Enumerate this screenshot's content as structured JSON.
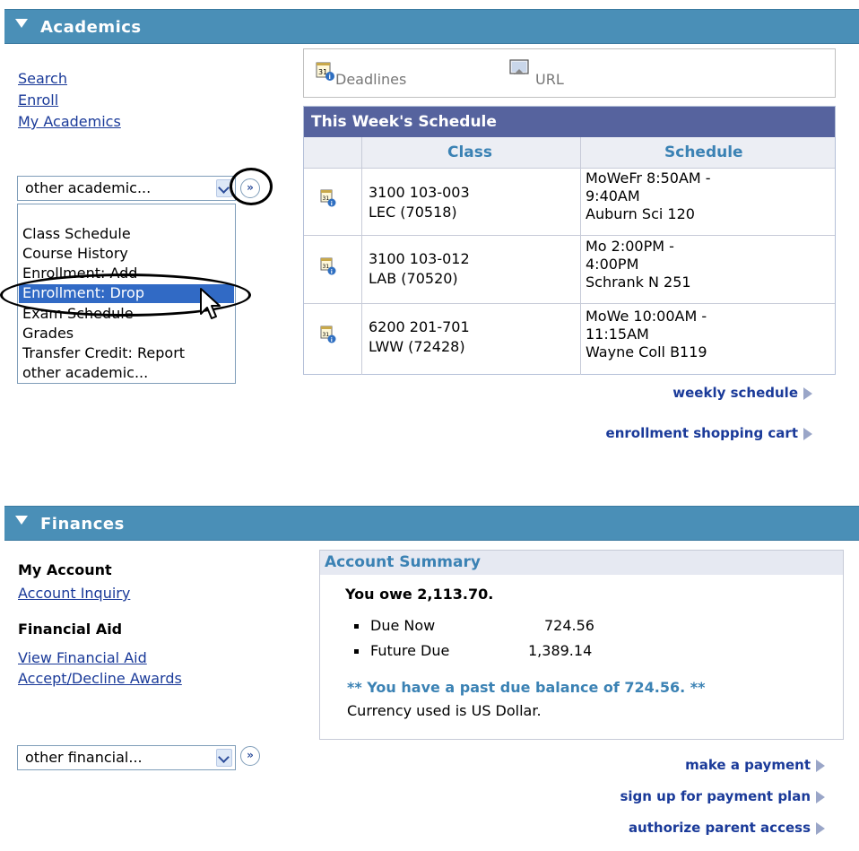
{
  "academics": {
    "header": "Academics",
    "links": [
      "Search",
      "Enroll",
      "My Academics"
    ],
    "select_value": "other academic...",
    "go_glyph": "»",
    "dropdown_options": [
      "Class Schedule",
      "Course History",
      "Enrollment: Add",
      "Enrollment: Drop",
      "Exam Schedule",
      "Grades",
      "Transfer Credit: Report",
      "other academic..."
    ],
    "selected_option": "Enrollment: Drop",
    "toolbar": {
      "deadlines": "Deadlines",
      "url": "URL"
    },
    "schedule": {
      "title": "This Week's Schedule",
      "columns": [
        "Class",
        "Schedule"
      ],
      "rows": [
        {
          "class_line1": "3100 103-003",
          "class_line2": "LEC (70518)",
          "sched_line1": "MoWeFr 8:50AM -",
          "sched_line2": "9:40AM",
          "sched_line3": "Auburn Sci 120"
        },
        {
          "class_line1": "3100 103-012",
          "class_line2": "LAB (70520)",
          "sched_line1": "Mo 2:00PM -",
          "sched_line2": "4:00PM",
          "sched_line3": "Schrank N 251"
        },
        {
          "class_line1": "6200 201-701",
          "class_line2": "LWW (72428)",
          "sched_line1": "MoWe 10:00AM -",
          "sched_line2": "11:15AM",
          "sched_line3": "Wayne Coll B119"
        }
      ]
    },
    "weekly_schedule": "weekly schedule",
    "shopping_cart": "enrollment shopping cart"
  },
  "finances": {
    "header": "Finances",
    "my_account_heading": "My Account",
    "account_inquiry": "Account Inquiry",
    "financial_aid_heading": "Financial Aid",
    "view_financial_aid": "View Financial Aid",
    "accept_decline": "Accept/Decline Awards",
    "select_value": "other financial...",
    "summary": {
      "title": "Account Summary",
      "owe": "You owe 2,113.70.",
      "due_now_label": "Due Now",
      "due_now_value": "724.56",
      "future_due_label": "Future Due",
      "future_due_value": "1,389.14",
      "past_due": "** You have a past due balance of 724.56. **",
      "currency": "Currency used is US Dollar."
    },
    "make_payment": "make a payment",
    "payment_plan": "sign up for payment plan",
    "parent_access": "authorize parent access"
  },
  "colors": {
    "header_blue": "#4a8fb7",
    "schedule_header": "#56639e",
    "link": "#1a3a99",
    "accent_text": "#3b82b4",
    "selection": "#316ac5"
  }
}
